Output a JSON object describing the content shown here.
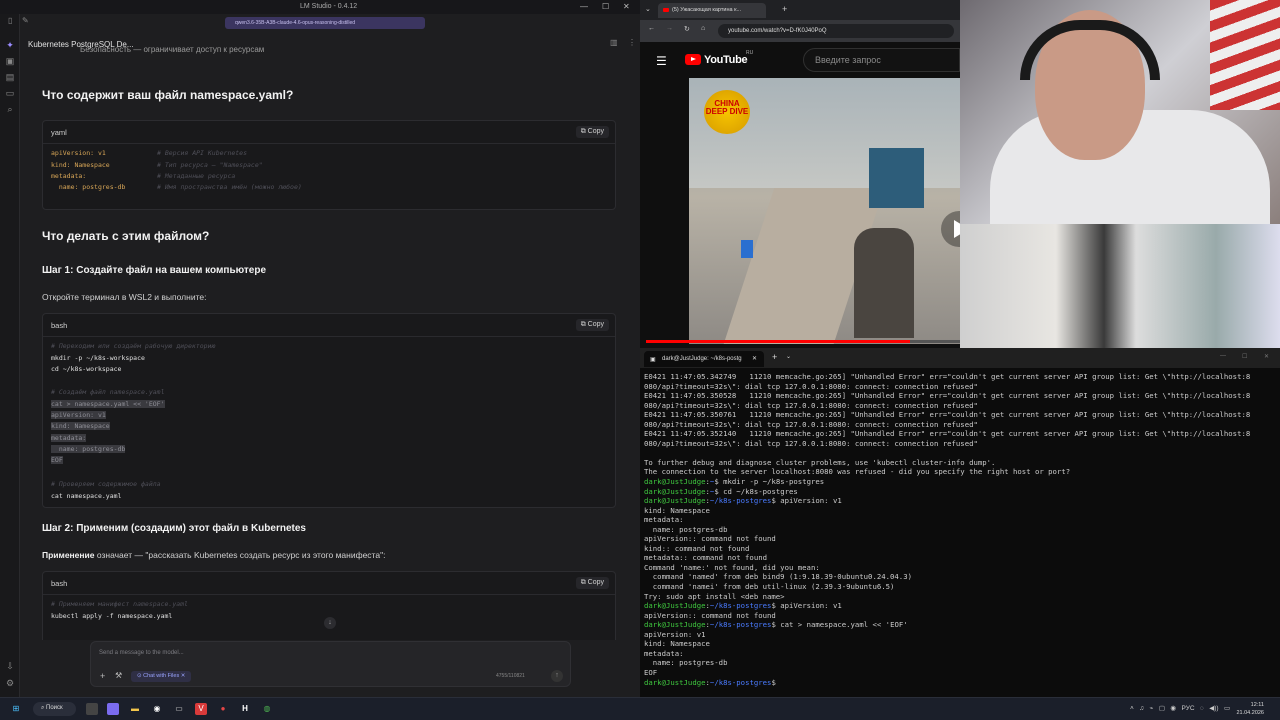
{
  "lm_studio": {
    "window_title": "LM Studio - 0.4.12",
    "chat_title": "Kubernetes PostgreSQL De...",
    "model": "qwen3.6-35B-A3B-claude-4.6-opus-reasoning-distilled",
    "top_cut_text": "Безопасность — ограничивает доступ к ресурсам",
    "sections": {
      "h_namespace": "Что содержит ваш файл namespace.yaml?",
      "h_what_to_do": "Что делать с этим файлом?",
      "h_step1": "Шаг 1: Создайте файл на вашем компьютере",
      "p_step1": "Откройте терминал в WSL2 и выполните:",
      "h_step2": "Шаг 2: Применим (создадим) этот файл в Kubernetes",
      "p_step2_bold": "Применение",
      "p_step2_rest": " означает — \"рассказать Kubernetes создать ресурс из этого манифеста\":"
    },
    "copy_label": "Copy",
    "code_yaml": {
      "lang": "yaml",
      "lines": [
        {
          "code": "apiVersion: v1",
          "comment": "# Версия API Kubernetes"
        },
        {
          "code": "kind: Namespace",
          "comment": "# Тип ресурса — \"Namespace\""
        },
        {
          "code": "metadata:",
          "comment": "# Метаданные ресурса"
        },
        {
          "code": "  name: postgres-db",
          "comment": "# Имя пространства имён (можно любое)"
        }
      ]
    },
    "code_bash1": {
      "lang": "bash",
      "l1": "# Переходим или создаём рабочую директорию",
      "l2": "mkdir -p ~/k8s-workspace",
      "l3": "cd ~/k8s-workspace",
      "l4": "# Создаём файл namespace.yaml",
      "l5": "cat > namespace.yaml << 'EOF'",
      "l6": "apiVersion: v1",
      "l7": "kind: Namespace",
      "l8": "metadata:",
      "l9": "  name: postgres-db",
      "l10": "EOF",
      "l11": "# Проверяем содержимое файла",
      "l12": "cat namespace.yaml"
    },
    "code_bash2": {
      "lang": "bash",
      "l1": "# Применяем манифест namespace.yaml",
      "l2": "kubectl apply -f namespace.yaml"
    },
    "composer": {
      "placeholder": "Send a message to the model...",
      "chip": "Chat with Files",
      "tokens": "4755/110821"
    }
  },
  "browser": {
    "tab_title": "(5) Ужасающая картина к...",
    "url": "youtube.com/watch?v=D-fK0J40PoQ",
    "brand": "YouTube",
    "region": "RU",
    "search_placeholder": "Введите запрос",
    "badge": "CHINA DEEP DIVE",
    "progress": 0.84
  },
  "terminal": {
    "tab_title": "dark@JustJudge: ~/k8s-postg",
    "errors": [
      "E0421 11:47:05.342749   11210 memcache.go:265] \"Unhandled Error\" err=\"couldn't get current server API group list: Get \\\"http://localhost:8",
      "080/api?timeout=32s\\\": dial tcp 127.0.0.1:8080: connect: connection refused\"",
      "E0421 11:47:05.350528   11210 memcache.go:265] \"Unhandled Error\" err=\"couldn't get current server API group list: Get \\\"http://localhost:8",
      "080/api?timeout=32s\\\": dial tcp 127.0.0.1:8080: connect: connection refused\"",
      "E0421 11:47:05.350761   11210 memcache.go:265] \"Unhandled Error\" err=\"couldn't get current server API group list: Get \\\"http://localhost:8",
      "080/api?timeout=32s\\\": dial tcp 127.0.0.1:8080: connect: connection refused\"",
      "E0421 11:47:05.352140   11210 memcache.go:265] \"Unhandled Error\" err=\"couldn't get current server API group list: Get \\\"http://localhost:8",
      "080/api?timeout=32s\\\": dial tcp 127.0.0.1:8080: connect: connection refused\""
    ],
    "info1": "To further debug and diagnose cluster problems, use 'kubectl cluster-info dump'.",
    "info2": "The connection to the server localhost:8080 was refused - did you specify the right host or port?",
    "prompt_user": "dark@JustJudge",
    "prompt_home": "~",
    "prompt_dir": "~/k8s-postgres",
    "cmd1": " mkdir -p ~/k8s-postgres",
    "cmd2": " cd ~/k8s-postgres",
    "cmd3": " apiVersion: v1",
    "out_a": [
      "kind: Namespace",
      "metadata:",
      "  name: postgres-db",
      "apiVersion:: command not found",
      "kind:: command not found",
      "metadata:: command not found",
      "Command 'name:' not found, did you mean:",
      "  command 'named' from deb bind9 (1:9.18.39-0ubuntu0.24.04.3)",
      "  command 'namei' from deb util-linux (2.39.3-9ubuntu6.5)",
      "Try: sudo apt install <deb name>"
    ],
    "cmd4": " apiVersion: v1",
    "out_b": "apiVersion:: command not found",
    "cmd5": " cat > namespace.yaml << 'EOF'",
    "out_c": [
      "apiVersion: v1",
      "kind: Namespace",
      "metadata:",
      "  name: postgres-db",
      "EOF"
    ]
  },
  "taskbar": {
    "search": "Поиск",
    "lang": "РУС",
    "time": "12:11",
    "date": "21.04.2026"
  }
}
